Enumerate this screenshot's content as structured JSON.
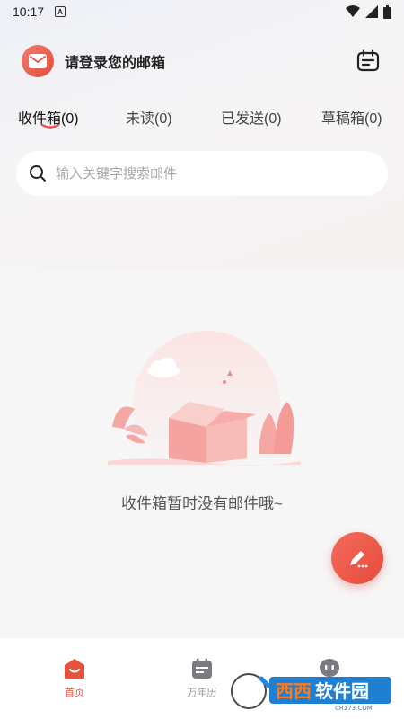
{
  "status_bar": {
    "time": "10:17",
    "a_indicator": "A",
    "icons": [
      "wifi-icon",
      "signal-icon",
      "battery-icon"
    ]
  },
  "header": {
    "title": "请登录您的邮箱",
    "logo_icon": "mail-icon",
    "calendar_icon": "calendar-icon"
  },
  "tabs": [
    {
      "label": "收件箱(0)",
      "active": true
    },
    {
      "label": "未读(0)",
      "active": false
    },
    {
      "label": "已发送(0)",
      "active": false
    },
    {
      "label": "草稿箱(0)",
      "active": false
    }
  ],
  "search": {
    "placeholder": "输入关键字搜索邮件",
    "icon": "search-icon"
  },
  "empty_state": {
    "message": "收件箱暂时没有邮件哦~",
    "illustration": "empty-box-illustration"
  },
  "fab": {
    "icon": "compose-pencil-icon"
  },
  "bottom_nav": [
    {
      "label": "首页",
      "icon": "home-icon",
      "active": true
    },
    {
      "label": "万年历",
      "icon": "calendar-icon",
      "active": false
    },
    {
      "label": "",
      "icon": "robot-icon",
      "active": false
    }
  ],
  "watermark": {
    "text": "西西软件园",
    "sub": "CR173.COM"
  },
  "colors": {
    "accent": "#e5533f",
    "background": "#f6f6f7",
    "illustration": "#f4a3a0"
  }
}
